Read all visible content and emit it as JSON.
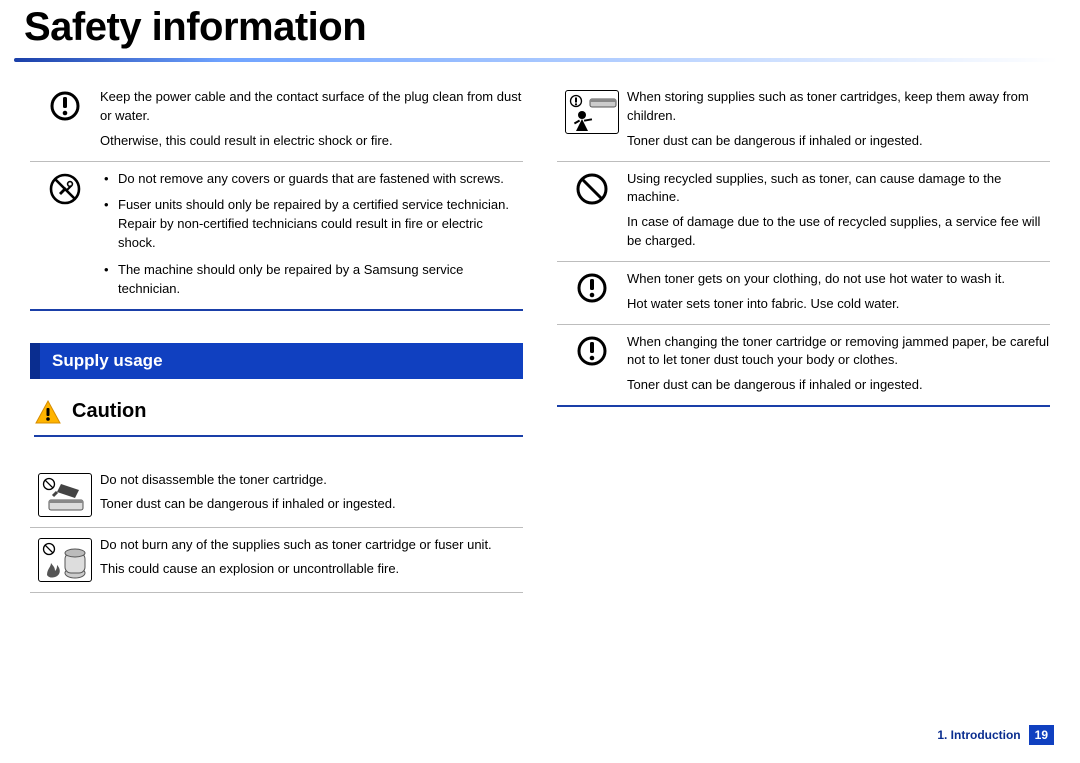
{
  "page": {
    "title": "Safety information",
    "section_heading": "Supply usage",
    "caution_label": "Caution",
    "footer_chapter": "1.  Introduction",
    "footer_page": "19"
  },
  "left_top": [
    {
      "icon": "exclaim-circle",
      "paras": [
        "Keep the power cable and the contact surface of the plug clean from dust or water.",
        "Otherwise, this could result in electric shock or fire."
      ]
    },
    {
      "icon": "no-tools",
      "bullets": [
        "Do not remove any covers or guards that are fastened with screws.",
        "Fuser units should only be repaired by a certified service technician. Repair by non-certified technicians could result in fire or electric shock.",
        "The machine should only be repaired by a Samsung service technician."
      ]
    }
  ],
  "left_after_caution": [
    {
      "icon": "no-disassemble-toner",
      "paras": [
        "Do not disassemble the toner cartridge.",
        "Toner dust can be dangerous if inhaled or ingested."
      ]
    },
    {
      "icon": "no-burn-supplies",
      "paras": [
        "Do not burn any of the supplies such as toner cartridge or fuser unit.",
        "This could cause an explosion or uncontrollable fire."
      ]
    }
  ],
  "right": [
    {
      "icon": "keep-away-children",
      "paras": [
        "When storing supplies such as toner cartridges, keep them away from children.",
        "Toner dust can be dangerous if inhaled or ingested."
      ]
    },
    {
      "icon": "prohibit-circle",
      "paras": [
        "Using recycled supplies, such as toner, can cause damage to the machine.",
        "In case of damage due to the use of recycled supplies, a service fee will be charged."
      ]
    },
    {
      "icon": "exclaim-circle",
      "paras": [
        "When toner gets on your clothing, do not use hot water to wash it.",
        "Hot water sets toner into fabric. Use cold water."
      ]
    },
    {
      "icon": "exclaim-circle",
      "paras": [
        "When changing the toner cartridge or removing jammed paper, be careful not to let toner dust touch your body or clothes.",
        "Toner dust can be dangerous if inhaled or ingested."
      ]
    }
  ]
}
